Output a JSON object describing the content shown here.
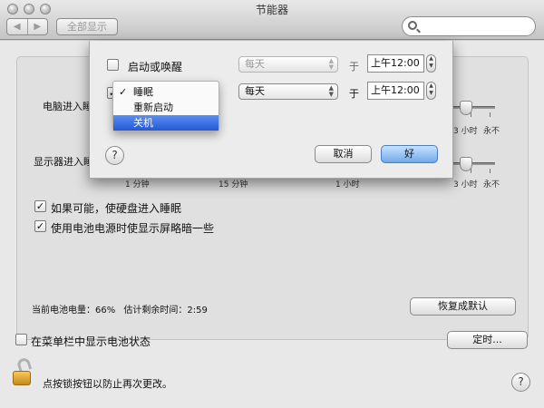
{
  "window": {
    "title": "节能器"
  },
  "toolbar": {
    "back_glyph": "◀",
    "forward_glyph": "▶",
    "show_all": "全部显示",
    "search_placeholder": ""
  },
  "sliders": {
    "computer_sleep_label": "电脑进入睡眠",
    "display_sleep_label": "显示器进入睡眠",
    "ticks": {
      "one_min": "1 分钟",
      "fifteen_min": "15 分钟",
      "one_hour": "1 小时",
      "three_hours": "3 小时",
      "never": "永不"
    }
  },
  "options": {
    "disk_sleep": {
      "label": "如果可能，使硬盘进入睡眠",
      "checked": true
    },
    "dim_on_battery": {
      "label": "使用电池电源时使显示屏略暗一些",
      "checked": true
    },
    "show_battery_menu": {
      "label": "在菜单栏中显示电池状态",
      "checked": false
    }
  },
  "battery": {
    "charge_label": "当前电池电量：",
    "charge": "66%",
    "remaining_label": "估计剩余时间：",
    "remaining": "2:59"
  },
  "buttons": {
    "restore_defaults": "恢复成默认",
    "schedule": "定时...",
    "help": "?"
  },
  "lock": {
    "text": "点按锁按钮以防止再次更改。"
  },
  "schedule_sheet": {
    "row1": {
      "label": "启动或唤醒",
      "checked": false,
      "frequency": "每天",
      "at": "于",
      "time": "上午12:00"
    },
    "row2": {
      "action": "睡眠",
      "checked": true,
      "frequency": "每天",
      "at": "于",
      "time": "上午12:00"
    },
    "cancel": "取消",
    "ok": "好",
    "help": "?"
  },
  "action_menu": {
    "items": [
      {
        "label": "睡眠",
        "checked": true,
        "highlighted": false
      },
      {
        "label": "重新启动",
        "checked": false,
        "highlighted": false
      },
      {
        "label": "关机",
        "checked": false,
        "highlighted": true
      }
    ],
    "check_glyph": "✓"
  },
  "colors": {
    "accent": "#2458d6",
    "default_button": "#6fa9e9",
    "lock_gold": "#e0a83a"
  }
}
